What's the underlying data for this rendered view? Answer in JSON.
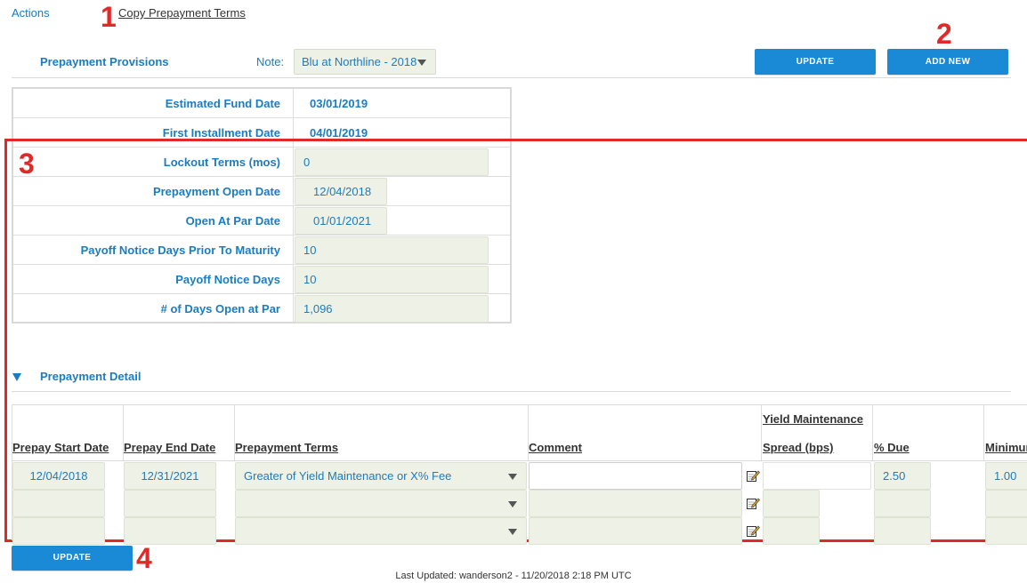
{
  "header": {
    "actions": "Actions",
    "copy_terms": "Copy Prepayment Terms"
  },
  "markers": [
    "1",
    "2",
    "3",
    "4"
  ],
  "provisions": {
    "title": "Prepayment Provisions",
    "note_label": "Note:",
    "note_value": "Blu at Northline - 2018",
    "update_button": "UPDATE",
    "add_new_button": "ADD NEW"
  },
  "fields": [
    {
      "label": "Estimated Fund Date",
      "value": "03/01/2019"
    },
    {
      "label": "First Installment Date",
      "value": "04/01/2019"
    },
    {
      "label": "Lockout Terms (mos)",
      "value": "0"
    },
    {
      "label": "Prepayment Open Date",
      "value": "12/04/2018"
    },
    {
      "label": "Open At Par Date",
      "value": "01/01/2021"
    },
    {
      "label": "Payoff Notice Days Prior To Maturity",
      "value": "10"
    },
    {
      "label": "Payoff Notice Days",
      "value": "10"
    },
    {
      "label": "# of Days Open at Par",
      "value": "1,096"
    }
  ],
  "detail": {
    "title": "Prepayment Detail",
    "columns": {
      "start": "Prepay Start Date",
      "end": "Prepay End Date",
      "terms": "Prepayment Terms",
      "comment": "Comment",
      "ym_top": "Yield Maintenance",
      "ym_bottom": "Spread (bps)",
      "due": "% Due",
      "minimum": "Minimum"
    },
    "rows": [
      {
        "start": "12/04/2018",
        "end": "12/31/2021",
        "terms": "Greater of Yield Maintenance or X% Fee",
        "comment": "",
        "spread": "",
        "due": "2.50",
        "minimum": "1.00"
      },
      {
        "start": "",
        "end": "",
        "terms": "",
        "comment": "",
        "spread": "",
        "due": "",
        "minimum": ""
      },
      {
        "start": "",
        "end": "",
        "terms": "",
        "comment": "",
        "spread": "",
        "due": "",
        "minimum": ""
      }
    ],
    "update_button": "UPDATE"
  },
  "footer": {
    "text": "Last Updated: wanderson2 - 11/20/2018 2:18 PM UTC"
  }
}
